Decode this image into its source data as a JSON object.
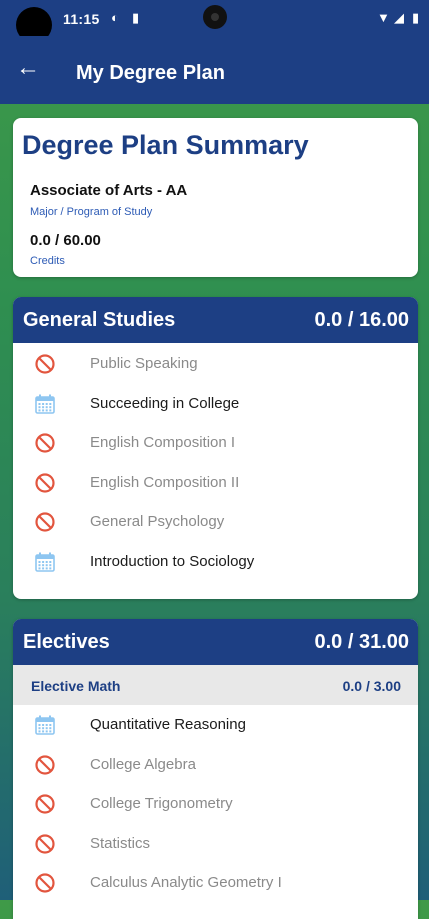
{
  "status_bar": {
    "time": "11:15"
  },
  "app_bar": {
    "title": "My Degree Plan"
  },
  "summary": {
    "heading": "Degree Plan Summary",
    "program": "Associate of Arts - AA",
    "program_label": "Major / Program of Study",
    "credits": "0.0 / 60.00",
    "credits_label": "Credits"
  },
  "general_studies": {
    "title": "General Studies",
    "credits": "0.0 / 16.00",
    "courses": [
      {
        "label": "Public Speaking",
        "status": "not-planned",
        "icon": "no-entry-icon"
      },
      {
        "label": "Succeeding in College",
        "status": "planned",
        "icon": "calendar-icon"
      },
      {
        "label": "English Composition I",
        "status": "not-planned",
        "icon": "no-entry-icon"
      },
      {
        "label": "English Composition II",
        "status": "not-planned",
        "icon": "no-entry-icon"
      },
      {
        "label": "General Psychology",
        "status": "not-planned",
        "icon": "no-entry-icon"
      },
      {
        "label": "Introduction to Sociology",
        "status": "planned",
        "icon": "calendar-icon"
      }
    ]
  },
  "electives": {
    "title": "Electives",
    "credits": "0.0 / 31.00",
    "group": {
      "title": "Elective Math",
      "credits": "0.0 / 3.00"
    },
    "courses": [
      {
        "label": "Quantitative Reasoning",
        "status": "planned",
        "icon": "calendar-icon"
      },
      {
        "label": "College Algebra",
        "status": "not-planned",
        "icon": "no-entry-icon"
      },
      {
        "label": "College Trigonometry",
        "status": "not-planned",
        "icon": "no-entry-icon"
      },
      {
        "label": "Statistics",
        "status": "not-planned",
        "icon": "no-entry-icon"
      },
      {
        "label": "Calculus Analytic Geometry I",
        "status": "not-planned",
        "icon": "no-entry-icon"
      }
    ]
  },
  "colors": {
    "primary": "#1d3f84",
    "accent_text": "#2d5bb5",
    "no_entry_icon": "#e2553e",
    "calendar_icon": "#8ec6f1"
  }
}
